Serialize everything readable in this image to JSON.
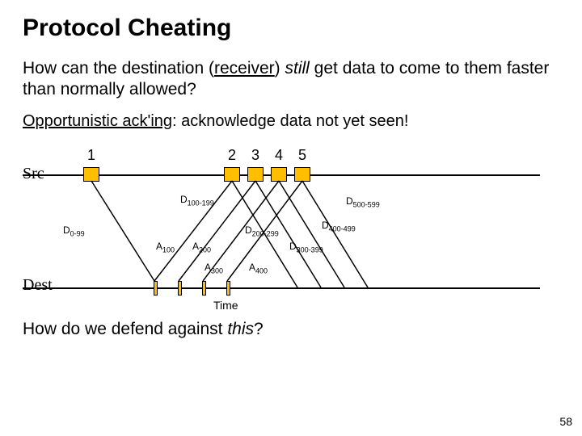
{
  "title": "Protocol Cheating",
  "question1": {
    "prefix": "How can the destination (",
    "receiver": "receiver",
    "mid": ") ",
    "still": "still",
    "suffix": " get data to come to them faster than normally allowed?"
  },
  "question2": {
    "term": "Opportunistic ack'ing",
    "rest": ": acknowledge data not yet seen!"
  },
  "diagram": {
    "src": "Src",
    "dest": "Dest",
    "packet_numbers": [
      "1",
      "2",
      "3",
      "4",
      "5"
    ],
    "labels": {
      "d0": "D",
      "d0sub": "0-99",
      "d1": "D",
      "d1sub": "100-199",
      "d2": "D",
      "d2sub": "200-299",
      "d3": "D",
      "d3sub": "300-399",
      "d4": "D",
      "d4sub": "400-499",
      "d5": "D",
      "d5sub": "500-599",
      "a1": "A",
      "a1sub": "100",
      "a2": "A",
      "a2sub": "200",
      "a3": "A",
      "a3sub": "300",
      "a4": "A",
      "a4sub": "400"
    },
    "time": "Time"
  },
  "question3": {
    "prefix": "How do we defend against ",
    "this": "this",
    "suffix": "?"
  },
  "slide_number": "58"
}
